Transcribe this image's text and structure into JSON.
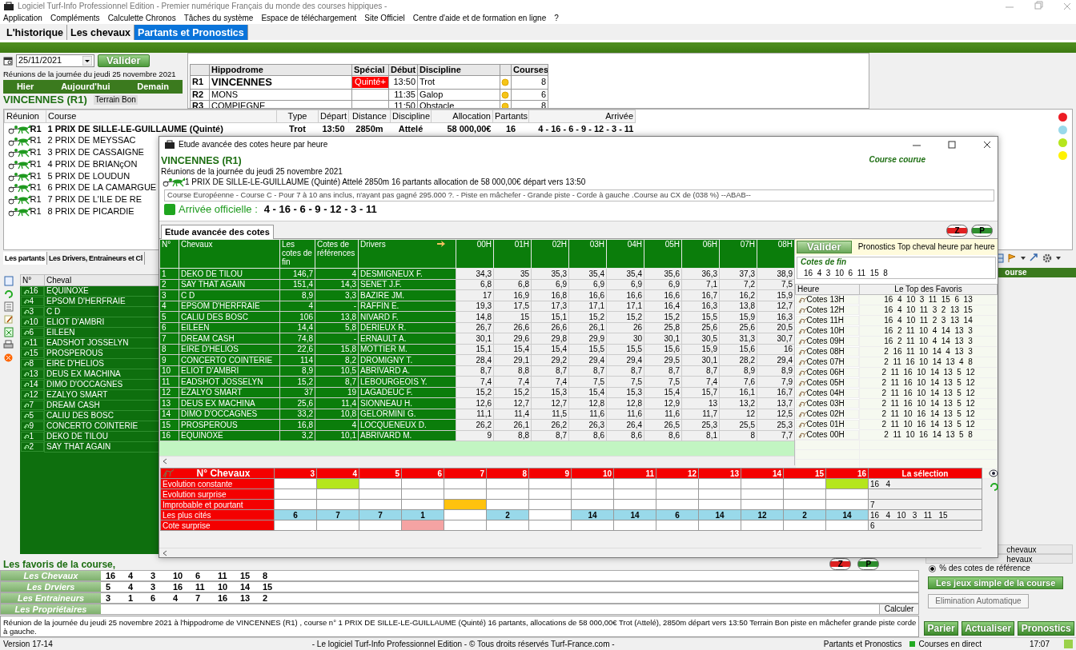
{
  "window": {
    "title": "Logiciel Turf-Info Professionnel Edition - Premier numérique Français du monde des courses hippiques -"
  },
  "menu": [
    "Application",
    "Compléments",
    "Calculette Chronos",
    "Tâches du système",
    "Espace de téléchargement",
    "Site Officiel",
    "Centre d'aide et de formation en ligne",
    "?"
  ],
  "tabs": [
    {
      "label": "L'historique",
      "selected": false
    },
    {
      "label": "Les chevaux",
      "selected": false
    },
    {
      "label": "Partants et Pronostics",
      "selected": true
    }
  ],
  "date_picker": {
    "value": "25/11/2021",
    "button": "Valider"
  },
  "day_text": "Réunions de la journée du jeudi 25 novembre 2021",
  "day_nav": [
    "Hier",
    "Aujourd'hui",
    "Demain"
  ],
  "venue": {
    "name": "VINCENNES (R1)",
    "terrain": "Terrain Bon"
  },
  "meetings": {
    "columns": [
      "Hippodrome",
      "Spécial",
      "Début",
      "Discipline",
      "Courses"
    ],
    "rows": [
      {
        "code": "R1",
        "name": "VINCENNES",
        "special": "Quinté+",
        "start": "13:50",
        "discipline": "Trot",
        "courses": "8",
        "selected": true
      },
      {
        "code": "R2",
        "name": "MONS",
        "start": "11:35",
        "discipline": "Galop",
        "courses": "6",
        "selected": false
      },
      {
        "code": "R3",
        "name": "COMPIEGNE",
        "start": "11:50",
        "discipline": "Obstacle",
        "courses": "8",
        "selected": false
      }
    ]
  },
  "races": {
    "columns": [
      "Réunion",
      "Course",
      "Type",
      "Départ",
      "Distance",
      "Discipline",
      "Allocation",
      "Partants",
      "Arrivée"
    ],
    "rows": [
      {
        "reunion": "R1",
        "course": "1 PRIX DE SILLE-LE-GUILLAUME (Quinté)",
        "type": "Trot",
        "depart": "13:50",
        "distance": "2850m",
        "discipline": "Attelé",
        "allocation": "58 000,00€",
        "partants": "16",
        "arrivee": "4 - 16 - 6 - 9 - 12 - 3 - 11",
        "selected": true
      },
      {
        "reunion": "R1",
        "course": "2 PRIX DE MEYSSAC",
        "selected": false
      },
      {
        "reunion": "R1",
        "course": "3 PRIX DE CASSAIGNE",
        "selected": false
      },
      {
        "reunion": "R1",
        "course": "4 PRIX DE BRIANçON",
        "selected": false
      },
      {
        "reunion": "R1",
        "course": "5 PRIX DE LOUDUN",
        "selected": false
      },
      {
        "reunion": "R1",
        "course": "6 PRIX DE LA CAMARGUE",
        "selected": false
      },
      {
        "reunion": "R1",
        "course": "7 PRIX DE L'ILE DE RE",
        "selected": false
      },
      {
        "reunion": "R1",
        "course": "8 PRIX DE PICARDIE",
        "selected": false
      }
    ]
  },
  "status_dots": [
    {
      "color": "#ed1c24"
    },
    {
      "color": "#99d9ea"
    },
    {
      "color": "#b5e61d"
    },
    {
      "color": "#fff200"
    }
  ],
  "lower_tabs": [
    {
      "label": "Les partants",
      "selected": true
    },
    {
      "label": "Les Drivers, Entraineurs et Cl",
      "selected": false
    }
  ],
  "partants": {
    "columns": [
      "N°",
      "Cheval"
    ],
    "rows": [
      {
        "num": "16",
        "name": "EQUINOXE"
      },
      {
        "num": "4",
        "name": "EPSOM D'HERFRAIE"
      },
      {
        "num": "3",
        "name": "C D"
      },
      {
        "num": "10",
        "name": "ELIOT D'AMBRI"
      },
      {
        "num": "6",
        "name": "EILEEN"
      },
      {
        "num": "11",
        "name": "EADSHOT JOSSELYN"
      },
      {
        "num": "15",
        "name": "PROSPEROUS"
      },
      {
        "num": "8",
        "name": "EIRE D'HELIOS"
      },
      {
        "num": "13",
        "name": "DEUS EX MACHINA"
      },
      {
        "num": "14",
        "name": "DIMO D'OCCAGNES"
      },
      {
        "num": "12",
        "name": "EZALYO SMART"
      },
      {
        "num": "7",
        "name": "DREAM CASH"
      },
      {
        "num": "5",
        "name": "CALIU DES BOSC"
      },
      {
        "num": "9",
        "name": "CONCERTO COINTERIE"
      },
      {
        "num": "1",
        "name": "DEKO DE TILOU"
      },
      {
        "num": "2",
        "name": "SAY THAT AGAIN"
      }
    ]
  },
  "right_panel": {
    "header": "ourse",
    "options": [
      "chevaux",
      "hevaux"
    ],
    "radio": {
      "label": "% des cotes de référence",
      "checked": true
    },
    "games_button": "Les jeux simple de la course",
    "auto_button": "Elimination Automatique",
    "actions": [
      "Parier",
      "Actualiser",
      "Pronostics"
    ]
  },
  "favoris": {
    "title": "Les favoris de la course,",
    "rows": [
      {
        "label": "Les Chevaux",
        "values": [
          "16",
          "4",
          "3",
          "10",
          "6",
          "11",
          "15",
          "8"
        ]
      },
      {
        "label": "Les Drviers",
        "values": [
          "5",
          "4",
          "3",
          "16",
          "11",
          "10",
          "14",
          "15"
        ]
      },
      {
        "label": "Les Entraineurs",
        "values": [
          "3",
          "1",
          "6",
          "4",
          "7",
          "16",
          "13",
          "2"
        ]
      },
      {
        "label": "Les Propriétaires",
        "values": []
      }
    ],
    "calculer": "Calculer",
    "z_button": "Z",
    "p_button": "P",
    "summary": "Réunion de la journée du jeudi 25 novembre 2021 à l'hippodrome de  VINCENNES (R1) , course n° 1 PRIX DE SILLE-LE-GUILLAUME (Quinté) 16 partants, allocations de 58 000,00€ Trot (Attelé), 2850m départ vers 13:50 Terrain Bon piste en mâchefer grande piste corde à gauche."
  },
  "status_bar": {
    "version": "Version 17-14",
    "copyright": "- Le logiciel Turf-Info Professionnel Edition - © Tous droits réservés Turf-France.com -",
    "mode": "Partants et Pronostics",
    "live": "Courses en direct",
    "time": "17:07"
  },
  "dialog": {
    "title": "Etude avancée des cotes heure par heure",
    "venue": "VINCENNES (R1)",
    "state": "Course courue",
    "day_text": "Réunions de la journée du jeudi 25 novembre 2021",
    "race": "1 PRIX DE SILLE-LE-GUILLAUME (Quinté) Attelé 2850m 16 partants allocation de 58 000,00€ départ vers 13:50",
    "conditions": "Course Européenne - Course C - Pour 7 à 10 ans inclus, n'ayant pas gagné 295.000 ?. - Piste en mâchefer - Grande piste - Corde à gauche .Course au CX de (038 %)  --ABAB--",
    "arrival_label": "Arrivée officielle :",
    "arrival": "4 - 16 - 6 - 9 - 12 - 3 - 11",
    "tab": "Etude avancée des cotes",
    "z_button": "Z",
    "p_button": "P",
    "odds": {
      "columns": [
        "N°",
        "Chevaux",
        "Les cotes de fin",
        "Cotes de références",
        "Drivers",
        "00H",
        "01H",
        "02H",
        "03H",
        "04H",
        "05H",
        "06H",
        "07H",
        "08H"
      ],
      "rows": [
        {
          "num": "1",
          "horse": "DEKO DE TILOU",
          "fin": "146,7",
          "ref": "4",
          "driver": "DESMIGNEUX F.",
          "odds": [
            "34,3",
            "35",
            "35,3",
            "35,4",
            "35,4",
            "35,6",
            "36,3",
            "37,3",
            "38,9"
          ]
        },
        {
          "num": "2",
          "horse": "SAY THAT AGAIN",
          "fin": "151,4",
          "ref": "14,3",
          "driver": "SENET J.F.",
          "odds": [
            "6,8",
            "6,8",
            "6,9",
            "6,9",
            "6,9",
            "6,9",
            "7,1",
            "7,2",
            "7,5"
          ]
        },
        {
          "num": "3",
          "horse": "C D",
          "fin": "8,9",
          "ref": "3,3",
          "driver": "BAZIRE JM.",
          "odds": [
            "17",
            "16,9",
            "16,8",
            "16,6",
            "16,6",
            "16,6",
            "16,7",
            "16,2",
            "15,9"
          ]
        },
        {
          "num": "4",
          "horse": "EPSOM D'HERFRAIE",
          "fin": "4",
          "ref": "-",
          "driver": "RAFFIN E.",
          "odds": [
            "19,3",
            "17,5",
            "17,3",
            "17,1",
            "17,1",
            "16,4",
            "16,3",
            "13,8",
            "12,7"
          ]
        },
        {
          "num": "5",
          "horse": "CALIU DES BOSC",
          "fin": "106",
          "ref": "13,8",
          "driver": "NIVARD F.",
          "odds": [
            "14,8",
            "15",
            "15,1",
            "15,2",
            "15,2",
            "15,2",
            "15,5",
            "15,9",
            "16,3"
          ]
        },
        {
          "num": "6",
          "horse": "EILEEN",
          "fin": "14,4",
          "ref": "5,8",
          "driver": "DERIEUX R.",
          "odds": [
            "26,7",
            "26,6",
            "26,6",
            "26,1",
            "26",
            "25,8",
            "25,6",
            "25,6",
            "20,5"
          ]
        },
        {
          "num": "7",
          "horse": "DREAM CASH",
          "fin": "74,8",
          "ref": "-",
          "driver": "ERNAULT A.",
          "odds": [
            "30,1",
            "29,6",
            "29,8",
            "29,9",
            "30",
            "30,1",
            "30,5",
            "31,3",
            "30,7"
          ]
        },
        {
          "num": "8",
          "horse": "EIRE D'HELIOS",
          "fin": "22,6",
          "ref": "15,8",
          "driver": "MOTTIER M.",
          "odds": [
            "15,1",
            "15,4",
            "15,4",
            "15,5",
            "15,5",
            "15,6",
            "15,9",
            "15,6",
            "16"
          ]
        },
        {
          "num": "9",
          "horse": "CONCERTO COINTERIE",
          "fin": "114",
          "ref": "8,2",
          "driver": "DROMIGNY T.",
          "odds": [
            "28,4",
            "29,1",
            "29,2",
            "29,4",
            "29,4",
            "29,5",
            "30,1",
            "28,2",
            "29,4"
          ]
        },
        {
          "num": "10",
          "horse": "ELIOT D'AMBRI",
          "fin": "8,9",
          "ref": "10,5",
          "driver": "ABRIVARD A.",
          "odds": [
            "8,7",
            "8,8",
            "8,7",
            "8,7",
            "8,7",
            "8,7",
            "8,7",
            "8,9",
            "8,9"
          ]
        },
        {
          "num": "11",
          "horse": "EADSHOT JOSSELYN",
          "fin": "15,2",
          "ref": "8,7",
          "driver": "LEBOURGEOIS Y.",
          "odds": [
            "7,4",
            "7,4",
            "7,4",
            "7,5",
            "7,5",
            "7,5",
            "7,4",
            "7,6",
            "7,9"
          ]
        },
        {
          "num": "12",
          "horse": "EZALYO SMART",
          "fin": "37",
          "ref": "19",
          "driver": "LAGADEUC F.",
          "odds": [
            "15,2",
            "15,2",
            "15,3",
            "15,4",
            "15,3",
            "15,4",
            "15,7",
            "16,1",
            "16,7"
          ]
        },
        {
          "num": "13",
          "horse": "DEUS EX MACHINA",
          "fin": "25,6",
          "ref": "11,4",
          "driver": "SIONNEAU H.",
          "odds": [
            "12,6",
            "12,7",
            "12,7",
            "12,8",
            "12,8",
            "12,9",
            "13",
            "13,2",
            "13,7"
          ]
        },
        {
          "num": "14",
          "horse": "DIMO D'OCCAGNES",
          "fin": "33,2",
          "ref": "10,8",
          "driver": "GELORMINI G.",
          "odds": [
            "11,1",
            "11,4",
            "11,5",
            "11,6",
            "11,6",
            "11,6",
            "11,7",
            "12",
            "12,5"
          ]
        },
        {
          "num": "15",
          "horse": "PROSPEROUS",
          "fin": "16,8",
          "ref": "4",
          "driver": "LOCQUENEUX D.",
          "odds": [
            "26,2",
            "26,1",
            "26,2",
            "26,3",
            "26,4",
            "26,5",
            "25,3",
            "25,5",
            "25,3"
          ]
        },
        {
          "num": "16",
          "horse": "EQUINOXE",
          "fin": "3,2",
          "ref": "10,1",
          "driver": "ABRIVARD M.",
          "odds": [
            "9",
            "8,8",
            "8,7",
            "8,6",
            "8,6",
            "8,6",
            "8,1",
            "8",
            "7,7"
          ]
        }
      ]
    },
    "prono": {
      "button": "Valider",
      "title": "Pronostics Top cheval heure par heure",
      "final_label": "Cotes de fin",
      "final": "16  4  3  10  6  11  15  8",
      "columns": [
        "Heure",
        "Le Top des Favoris"
      ],
      "rows": [
        {
          "hour": "Cotes 13H",
          "top": "16  4  10  3  11  15  6  13"
        },
        {
          "hour": "Cotes 12H",
          "top": "16  4  10  11  3  2  13  15"
        },
        {
          "hour": "Cotes 11H",
          "top": "16  4  10  11  2  3  13  14"
        },
        {
          "hour": "Cotes 10H",
          "top": "16  2  11  10  4  14  13  3"
        },
        {
          "hour": "Cotes 09H",
          "top": "16  2  11  10  4  14  13  3"
        },
        {
          "hour": "Cotes 08H",
          "top": "2  16  11  10  14  4  13  3"
        },
        {
          "hour": "Cotes 07H",
          "top": "2  11  16  10  14  13  4  8"
        },
        {
          "hour": "Cotes 06H",
          "top": "2  11  16  10  14  13  5  12"
        },
        {
          "hour": "Cotes 05H",
          "top": "2  11  16  10  14  13  5  12"
        },
        {
          "hour": "Cotes 04H",
          "top": "2  11  16  10  14  13  5  12"
        },
        {
          "hour": "Cotes 03H",
          "top": "2  11  16  10  14  13  5  12"
        },
        {
          "hour": "Cotes 02H",
          "top": "2  11  10  16  14  13  5  12"
        },
        {
          "hour": "Cotes 01H",
          "top": "2  11  10  16  14  13  5  12"
        },
        {
          "hour": "Cotes 00H",
          "top": "2  11  10  16  14  13  5  8"
        }
      ]
    },
    "selection": {
      "header": "N° Chevaux",
      "numbers": [
        "3",
        "4",
        "5",
        "6",
        "7",
        "8",
        "9",
        "10",
        "11",
        "12",
        "13",
        "14",
        "15",
        "16"
      ],
      "selection_header": "La sélection",
      "rows": [
        {
          "label": "Evolution constante",
          "selection": "16   4",
          "cells": [
            {
              "color": "#ffffff"
            },
            {
              "color": "#b5e61d"
            },
            {
              "color": "#ffffff"
            },
            {
              "color": "#ffffff"
            },
            {
              "color": "#ffffff"
            },
            {
              "color": "#ffffff"
            },
            {
              "color": "#ffffff"
            },
            {
              "color": "#ffffff"
            },
            {
              "color": "#ffffff"
            },
            {
              "color": "#ffffff"
            },
            {
              "color": "#ffffff"
            },
            {
              "color": "#ffffff"
            },
            {
              "color": "#ffffff"
            },
            {
              "color": "#b5e61d"
            }
          ]
        },
        {
          "label": "Evolution surprise",
          "cells": [
            {
              "color": "#ffffff"
            },
            {
              "color": "#ffffff"
            },
            {
              "color": "#ffffff"
            },
            {
              "color": "#ffffff"
            },
            {
              "color": "#ffffff"
            },
            {
              "color": "#ffffff"
            },
            {
              "color": "#ffffff"
            },
            {
              "color": "#ffffff"
            },
            {
              "color": "#ffffff"
            },
            {
              "color": "#ffffff"
            },
            {
              "color": "#ffffff"
            },
            {
              "color": "#ffffff"
            },
            {
              "color": "#ffffff"
            },
            {
              "color": "#ffffff"
            }
          ]
        },
        {
          "label": "Improbable et pourtant",
          "selection": "7",
          "cells": [
            {
              "color": "#ffffff"
            },
            {
              "color": "#ffffff"
            },
            {
              "color": "#ffffff"
            },
            {
              "color": "#ffffff"
            },
            {
              "color": "#ffc20e"
            },
            {
              "color": "#ffffff"
            },
            {
              "color": "#ffffff"
            },
            {
              "color": "#ffffff"
            },
            {
              "color": "#ffffff"
            },
            {
              "color": "#ffffff"
            },
            {
              "color": "#ffffff"
            },
            {
              "color": "#ffffff"
            },
            {
              "color": "#ffffff"
            },
            {
              "color": "#ffffff"
            }
          ]
        },
        {
          "label": "Les plus cités",
          "selection": "16   4   10   3   11   15",
          "cells": [
            {
              "value": "6",
              "color": "#99d9ea"
            },
            {
              "value": "7",
              "color": "#99d9ea"
            },
            {
              "value": "7",
              "color": "#99d9ea"
            },
            {
              "value": "1",
              "color": "#99d9ea"
            },
            {
              "color": "#ffffff"
            },
            {
              "value": "2",
              "color": "#99d9ea"
            },
            {
              "color": "#ffffff"
            },
            {
              "value": "14",
              "color": "#99d9ea"
            },
            {
              "value": "14",
              "color": "#99d9ea"
            },
            {
              "value": "6",
              "color": "#99d9ea"
            },
            {
              "value": "14",
              "color": "#99d9ea"
            },
            {
              "value": "12",
              "color": "#99d9ea"
            },
            {
              "value": "2",
              "color": "#99d9ea"
            },
            {
              "value": "14",
              "color": "#99d9ea"
            }
          ]
        },
        {
          "label": "Cote surprise",
          "selection": "6",
          "cells": [
            {
              "color": "#ffffff"
            },
            {
              "color": "#ffffff"
            },
            {
              "color": "#ffffff"
            },
            {
              "color": "#f5a3a3"
            },
            {
              "color": "#ffffff"
            },
            {
              "color": "#ffffff"
            },
            {
              "color": "#ffffff"
            },
            {
              "color": "#ffffff"
            },
            {
              "color": "#ffffff"
            },
            {
              "color": "#ffffff"
            },
            {
              "color": "#ffffff"
            },
            {
              "color": "#ffffff"
            },
            {
              "color": "#ffffff"
            },
            {
              "color": "#ffffff"
            }
          ]
        }
      ]
    }
  }
}
